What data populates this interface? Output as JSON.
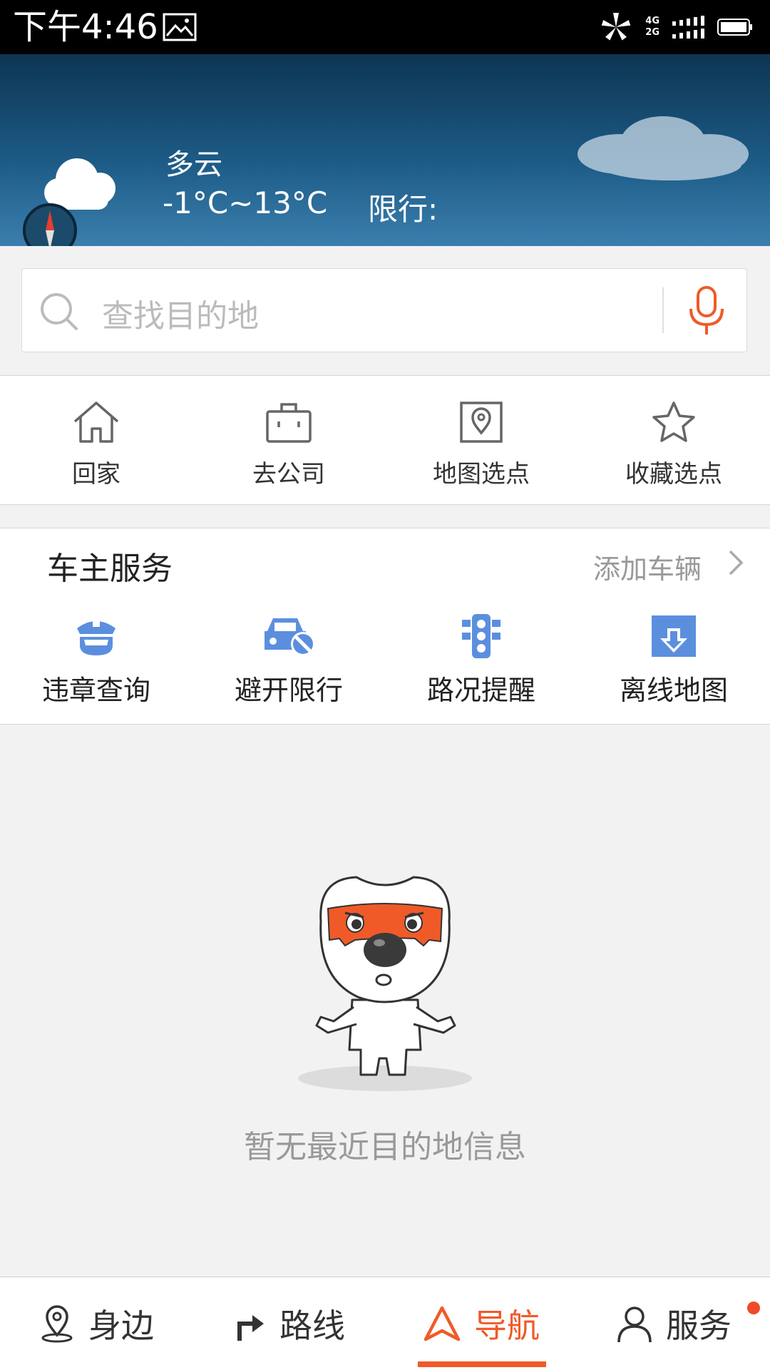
{
  "status_bar": {
    "time": "下午4:46",
    "net_top": "4G",
    "net_bottom": "2G"
  },
  "weather": {
    "condition": "多云",
    "temperature": "-1°C~13°C",
    "restriction": "限行:"
  },
  "search": {
    "placeholder": "查找目的地"
  },
  "quick_actions": [
    {
      "label": "回家",
      "icon": "home-icon"
    },
    {
      "label": "去公司",
      "icon": "briefcase-icon"
    },
    {
      "label": "地图选点",
      "icon": "map-pin-icon"
    },
    {
      "label": "收藏选点",
      "icon": "star-icon"
    }
  ],
  "owner_services": {
    "title": "车主服务",
    "add_vehicle": "添加车辆",
    "items": [
      {
        "label": "违章查询",
        "icon": "police-cap-icon"
      },
      {
        "label": "避开限行",
        "icon": "car-restriction-icon"
      },
      {
        "label": "路况提醒",
        "icon": "traffic-light-icon"
      },
      {
        "label": "离线地图",
        "icon": "offline-map-download-icon"
      }
    ]
  },
  "empty_state": {
    "message": "暂无最近目的地信息"
  },
  "bottom_nav": [
    {
      "label": "身边",
      "icon": "location-pin-icon",
      "active": false
    },
    {
      "label": "路线",
      "icon": "route-turn-icon",
      "active": false
    },
    {
      "label": "导航",
      "icon": "navigation-arrow-icon",
      "active": true
    },
    {
      "label": "服务",
      "icon": "user-service-icon",
      "active": false,
      "badge": true
    }
  ],
  "colors": {
    "accent": "#f05a28",
    "service_icon_blue": "#5b8fde",
    "status_bar_bg": "#000000",
    "page_bg": "#f2f2f2"
  }
}
